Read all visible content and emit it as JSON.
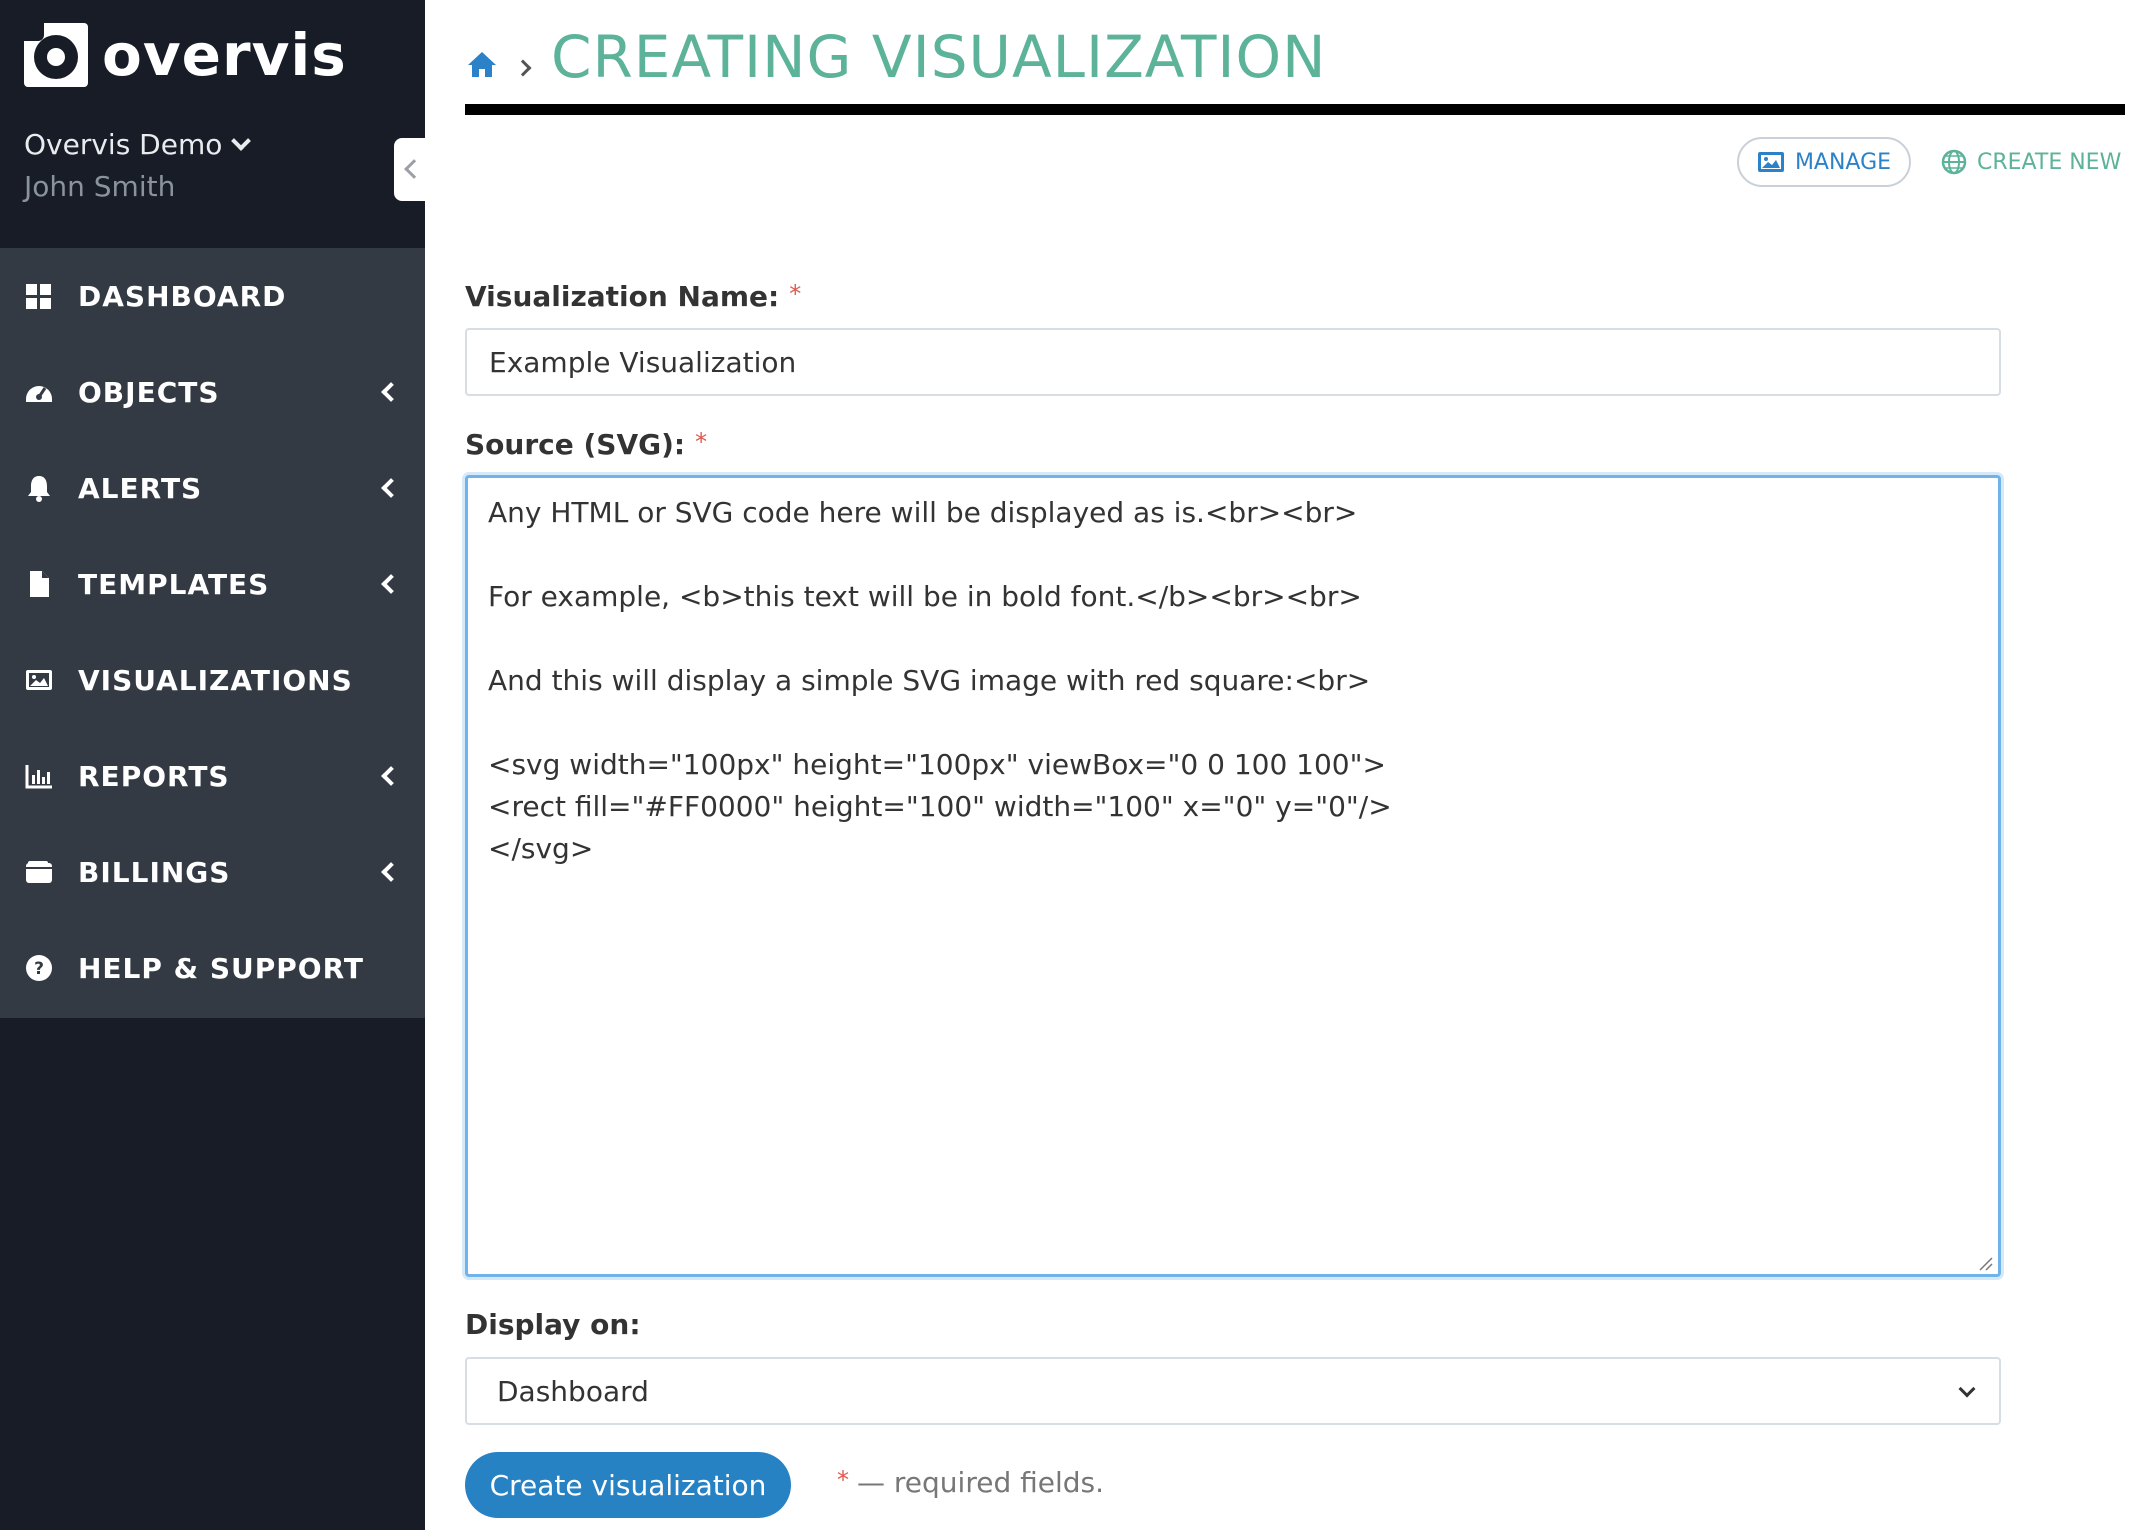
{
  "brand": {
    "name": "overvis"
  },
  "account": {
    "org": "Overvis Demo",
    "user": "John Smith"
  },
  "menu": [
    {
      "label": "DASHBOARD",
      "icon": "dashboard-icon",
      "has_submenu": false
    },
    {
      "label": "OBJECTS",
      "icon": "gauge-icon",
      "has_submenu": true
    },
    {
      "label": "ALERTS",
      "icon": "bell-icon",
      "has_submenu": true
    },
    {
      "label": "TEMPLATES",
      "icon": "file-icon",
      "has_submenu": true
    },
    {
      "label": "VISUALIZATIONS",
      "icon": "image-icon",
      "has_submenu": false
    },
    {
      "label": "REPORTS",
      "icon": "bar-chart-icon",
      "has_submenu": true
    },
    {
      "label": "BILLINGS",
      "icon": "wallet-icon",
      "has_submenu": true
    },
    {
      "label": "HELP & SUPPORT",
      "icon": "question-circle-icon",
      "has_submenu": false
    }
  ],
  "header": {
    "title": "CREATING VISUALIZATION"
  },
  "actions": {
    "manage": "MANAGE",
    "create_new": "CREATE NEW"
  },
  "form": {
    "name_label": "Visualization Name:",
    "name_value": "Example Visualization",
    "source_label": "Source (SVG):",
    "source_value": "Any HTML or SVG code here will be displayed as is.<br><br>\n\nFor example, <b>this text will be in bold font.</b><br><br>\n\nAnd this will display a simple SVG image with red square:<br>\n\n<svg width=\"100px\" height=\"100px\" viewBox=\"0 0 100 100\">\n<rect fill=\"#FF0000\" height=\"100\" width=\"100\" x=\"0\" y=\"0\"/>\n</svg>",
    "display_label": "Display on:",
    "display_value": "Dashboard",
    "submit_label": "Create visualization",
    "required_star": "*",
    "required_note": "— required fields."
  },
  "colors": {
    "sidebar_bg": "#171c26",
    "menu_bg": "#343a44",
    "title_green": "#5cb399",
    "primary_blue": "#2782c4",
    "required_red": "#e0574f"
  }
}
